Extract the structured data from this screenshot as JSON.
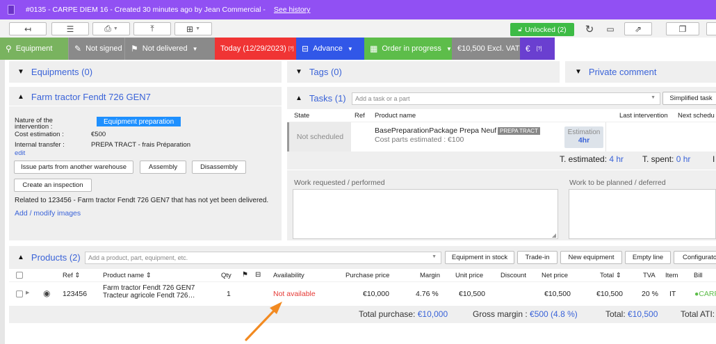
{
  "titlebar": {
    "text": "#0135  -  CARPE DIEM 16  -  Created 30 minutes ago by Jean Commercial  -",
    "link": "See history"
  },
  "toolbar": {
    "unlocked_label": "Unlocked (2)"
  },
  "statusbar": {
    "equipment": "Equipment",
    "not_signed": "Not signed",
    "not_delivered": "Not delivered",
    "today": "Today (12/29/2023)",
    "today_help": "[?]",
    "advance": "Advance",
    "order": "Order in progress",
    "amount": "€10,500 Excl. VAT",
    "extra_help": "[?]"
  },
  "sections": {
    "equipments": "Equipments (0)",
    "tags": "Tags (0)",
    "private_comment": "Private comment"
  },
  "equipment_panel": {
    "title": "Farm tractor Fendt 726 GEN7",
    "nature_label": "Nature of the intervention :",
    "nature_value": "Equipment preparation",
    "cost_label": "Cost estimation :",
    "cost_value": "€500",
    "transfer_label": "Internal transfer :",
    "transfer_value": "PREPA TRACT - frais Préparation",
    "edit": "edit",
    "btn_issue": "Issue parts from another warehouse",
    "btn_assembly": "Assembly",
    "btn_disassembly": "Disassembly",
    "btn_inspection": "Create an inspection",
    "related_text": "Related to 123456 - Farm tractor Fendt 726 GEN7 that has not yet been delivered.",
    "add_images": "Add / modify images"
  },
  "tasks_panel": {
    "title": "Tasks (1)",
    "add_placeholder": "Add a task or a part",
    "simplified_btn": "Simplified task",
    "col_state": "State",
    "col_ref": "Ref",
    "col_product": "Product name",
    "col_last": "Last intervention",
    "col_next": "Next schedu",
    "row_state": "Not scheduled",
    "row_product": "BasePreparationPackage Prepa Neuf",
    "row_badge": "PREPA TRACT",
    "row_cost": "Cost parts estimated : €100",
    "row_est_label": "Estimation",
    "row_est_value": "4hr",
    "t_estimated_label": "T. estimated:",
    "t_estimated_value": "4 hr",
    "t_spent_label": "T. spent:",
    "t_spent_value": "0 hr",
    "work_requested": "Work requested / performed",
    "work_planned": "Work to be planned / deferred"
  },
  "products_panel": {
    "title": "Products (2)",
    "add_placeholder": "Add a product, part, equipment, etc.",
    "btn_stock": "Equipment in stock",
    "btn_tradein": "Trade-in",
    "btn_new": "New equipment",
    "btn_empty": "Empty line",
    "btn_config": "Configurato",
    "headers": {
      "ref": "Ref ⇕",
      "name": "Product name ⇕",
      "qty": "Qty",
      "availability": "Availability",
      "purchase": "Purchase price",
      "margin": "Margin",
      "unit": "Unit price",
      "discount": "Discount",
      "net": "Net price",
      "total": "Total ⇕",
      "tva": "TVA",
      "item": "Item",
      "bill": "Bill"
    },
    "row": {
      "ref": "123456",
      "name1": "Farm tractor Fendt 726 GEN7",
      "name2": "Tracteur agricole Fendt 726…",
      "qty": "1",
      "availability": "Not available",
      "purchase": "€10,000",
      "margin": "4.76 %",
      "unit": "€10,500",
      "net": "€10,500",
      "total": "€10,500",
      "tva": "20 %",
      "item": "IT",
      "bill": "CARP"
    },
    "totals": {
      "purchase_label": "Total purchase:",
      "purchase_value": "€10,000",
      "margin_label": "Gross margin :",
      "margin_value": "€500 (4.8 %)",
      "total_label": "Total:",
      "total_value": "€10,500",
      "ati_label": "Total ATI:"
    }
  },
  "colors": {
    "titlebar": "#9150f3",
    "equipment_seg": "#79b35f",
    "grey_seg": "#8a8a8a",
    "today_seg": "#f03434",
    "advance_seg": "#3157e8",
    "order_seg": "#5dbd4a",
    "amount_seg": "#6a3fd0",
    "link": "#3a63d8",
    "not_available": "#e53935",
    "arrow": "#f28a21",
    "unlocked": "#3dbb45"
  }
}
